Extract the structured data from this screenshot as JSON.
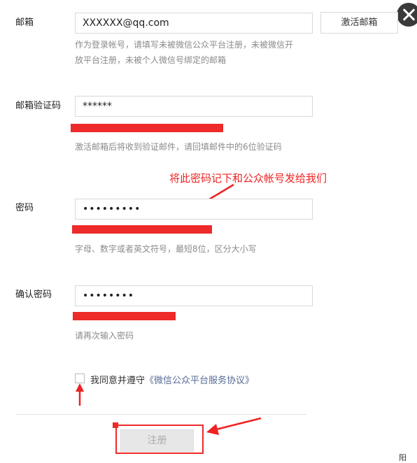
{
  "form": {
    "email": {
      "label": "邮箱",
      "value": "XXXXXX@qq.com",
      "activate_button": "激活邮箱",
      "hint": "作为登录帐号，请填写未被微信公众平台注册，未被微信开放平台注册，未被个人微信号绑定的邮箱"
    },
    "verify_code": {
      "label": "邮箱验证码",
      "value": "******",
      "hint": "激活邮箱后将收到验证邮件，请回填邮件中的6位验证码"
    },
    "password": {
      "label": "密码",
      "value": "•••••••••",
      "hint": "字母、数字或者英文符号，最短8位，区分大小写"
    },
    "confirm_password": {
      "label": "确认密码",
      "value": "••••••••",
      "hint": "请再次输入密码"
    },
    "agreement": {
      "text": "我同意并遵守",
      "link": "《微信公众平台服务协议》",
      "checked": false
    },
    "submit_label": "注册"
  },
  "annotation": {
    "text": "将此密码记下和公众帐号发给我们",
    "color": "#ee2222"
  },
  "edge_text": "阳"
}
